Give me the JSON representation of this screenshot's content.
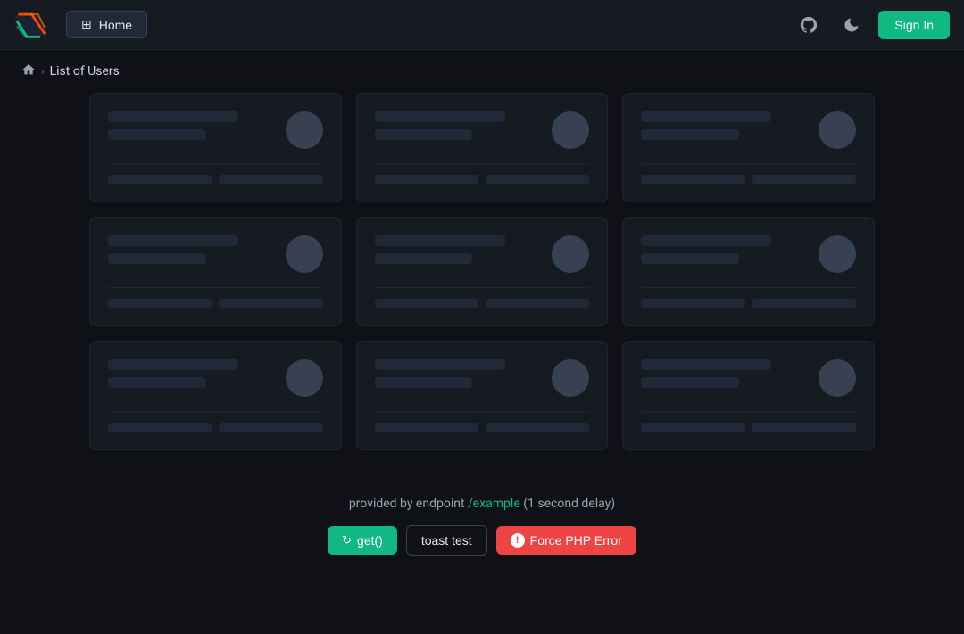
{
  "navbar": {
    "home_label": "Home",
    "signin_label": "Sign In",
    "home_icon": "⊞",
    "github_icon": "github",
    "moon_icon": "moon"
  },
  "breadcrumb": {
    "home_title": "Home",
    "separator": "›",
    "current": "List of Users"
  },
  "cards": [
    {
      "id": 1
    },
    {
      "id": 2
    },
    {
      "id": 3
    },
    {
      "id": 4
    },
    {
      "id": 5
    },
    {
      "id": 6
    },
    {
      "id": 7
    },
    {
      "id": 8
    },
    {
      "id": 9
    }
  ],
  "footer": {
    "provided_by": "provided by endpoint",
    "endpoint": "/example",
    "delay": "(1 second delay)",
    "get_label": "get()",
    "toast_label": "toast test",
    "force_error_label": "Force PHP Error"
  }
}
